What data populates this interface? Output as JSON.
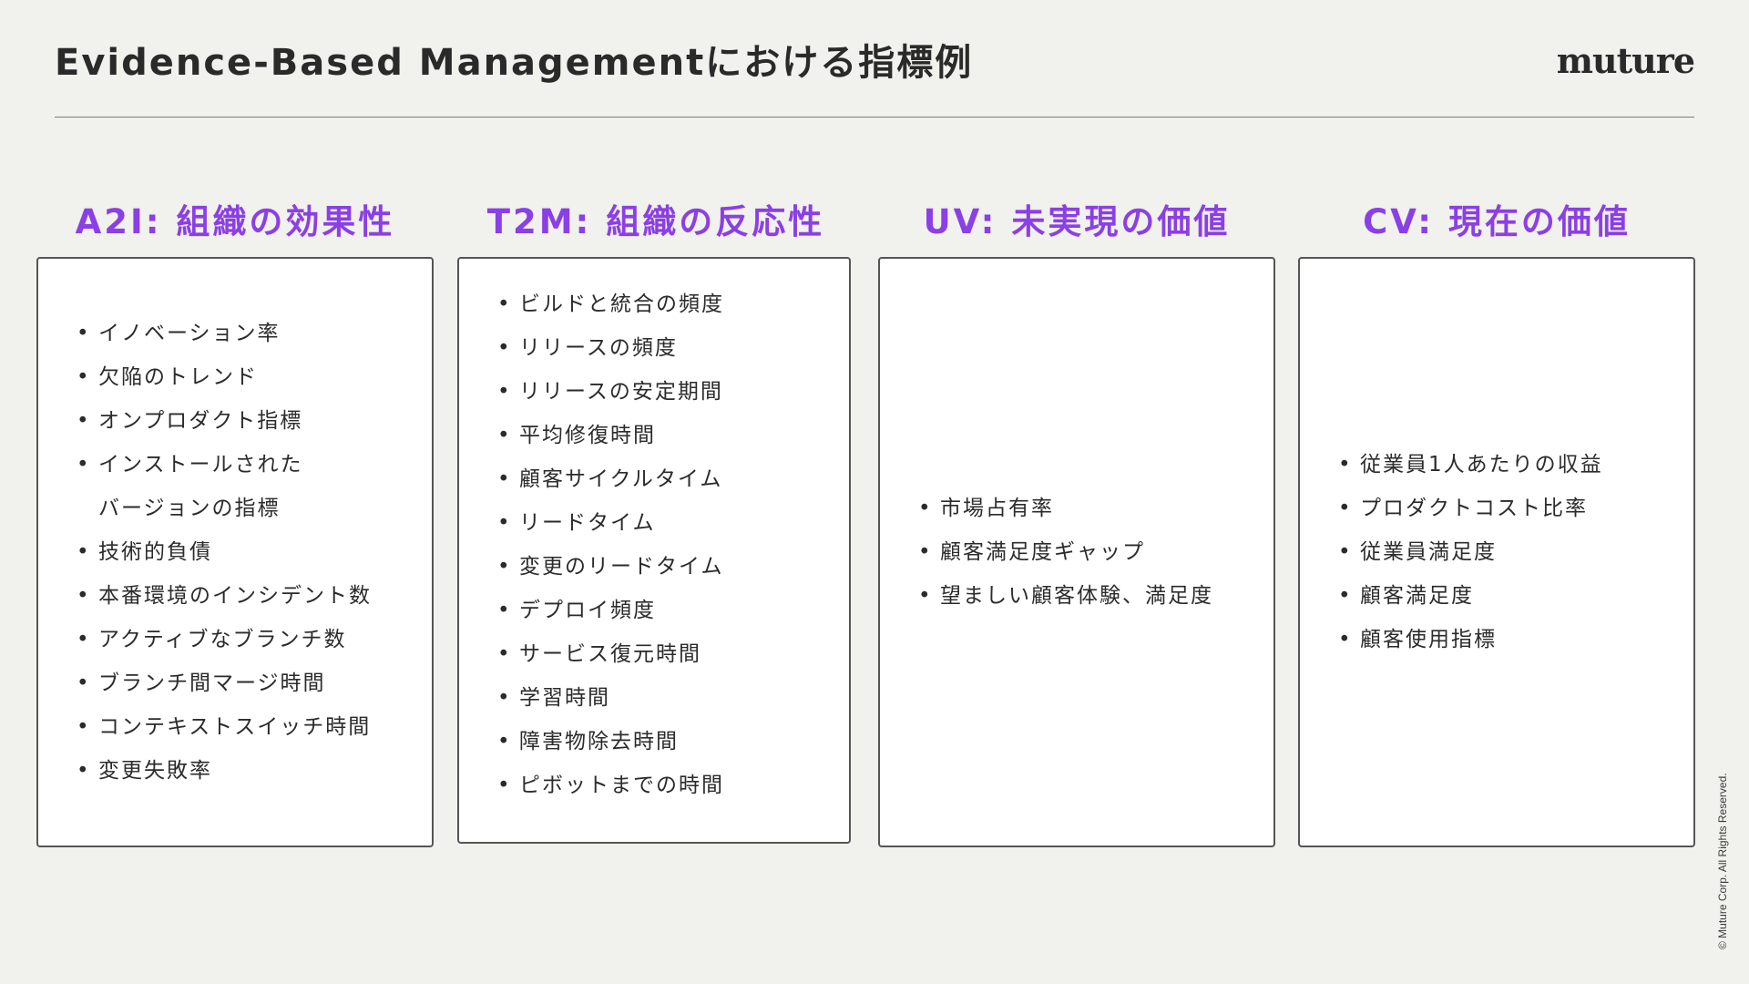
{
  "header": {
    "title": "Evidence-Based Managementにおける指標例",
    "logo": "muture"
  },
  "columns": [
    {
      "heading": "A2I: 組織の効果性",
      "items": [
        "イノベーション率",
        "欠陥のトレンド",
        "オンプロダクト指標",
        "インストールされた",
        "バージョンの指標",
        "技術的負債",
        "本番環境のインシデント数",
        "アクティブなブランチ数",
        "ブランチ間マージ時間",
        "コンテキストスイッチ時間",
        "変更失敗率"
      ]
    },
    {
      "heading": "T2M: 組織の反応性",
      "items": [
        "ビルドと統合の頻度",
        "リリースの頻度",
        "リリースの安定期間",
        "平均修復時間",
        "顧客サイクルタイム",
        "リードタイム",
        "変更のリードタイム",
        "デプロイ頻度",
        "サービス復元時間",
        "学習時間",
        "障害物除去時間",
        "ピボットまでの時間"
      ]
    },
    {
      "heading": "UV: 未実現の価値",
      "items": [
        "市場占有率",
        "顧客満足度ギャップ",
        "望ましい顧客体験、満足度"
      ]
    },
    {
      "heading": "CV: 現在の価値",
      "items": [
        "従業員1人あたりの収益",
        "プロダクトコスト比率",
        "従業員満足度",
        "顧客満足度",
        "顧客使用指標"
      ]
    }
  ],
  "bullet_char": "•",
  "copyright": "© Muture Corp. All Rights Reserved.",
  "colors": {
    "accent": "#8b3fe6",
    "background": "#f1f1ed",
    "card": "#ffffff",
    "text": "#2b2b2b"
  }
}
